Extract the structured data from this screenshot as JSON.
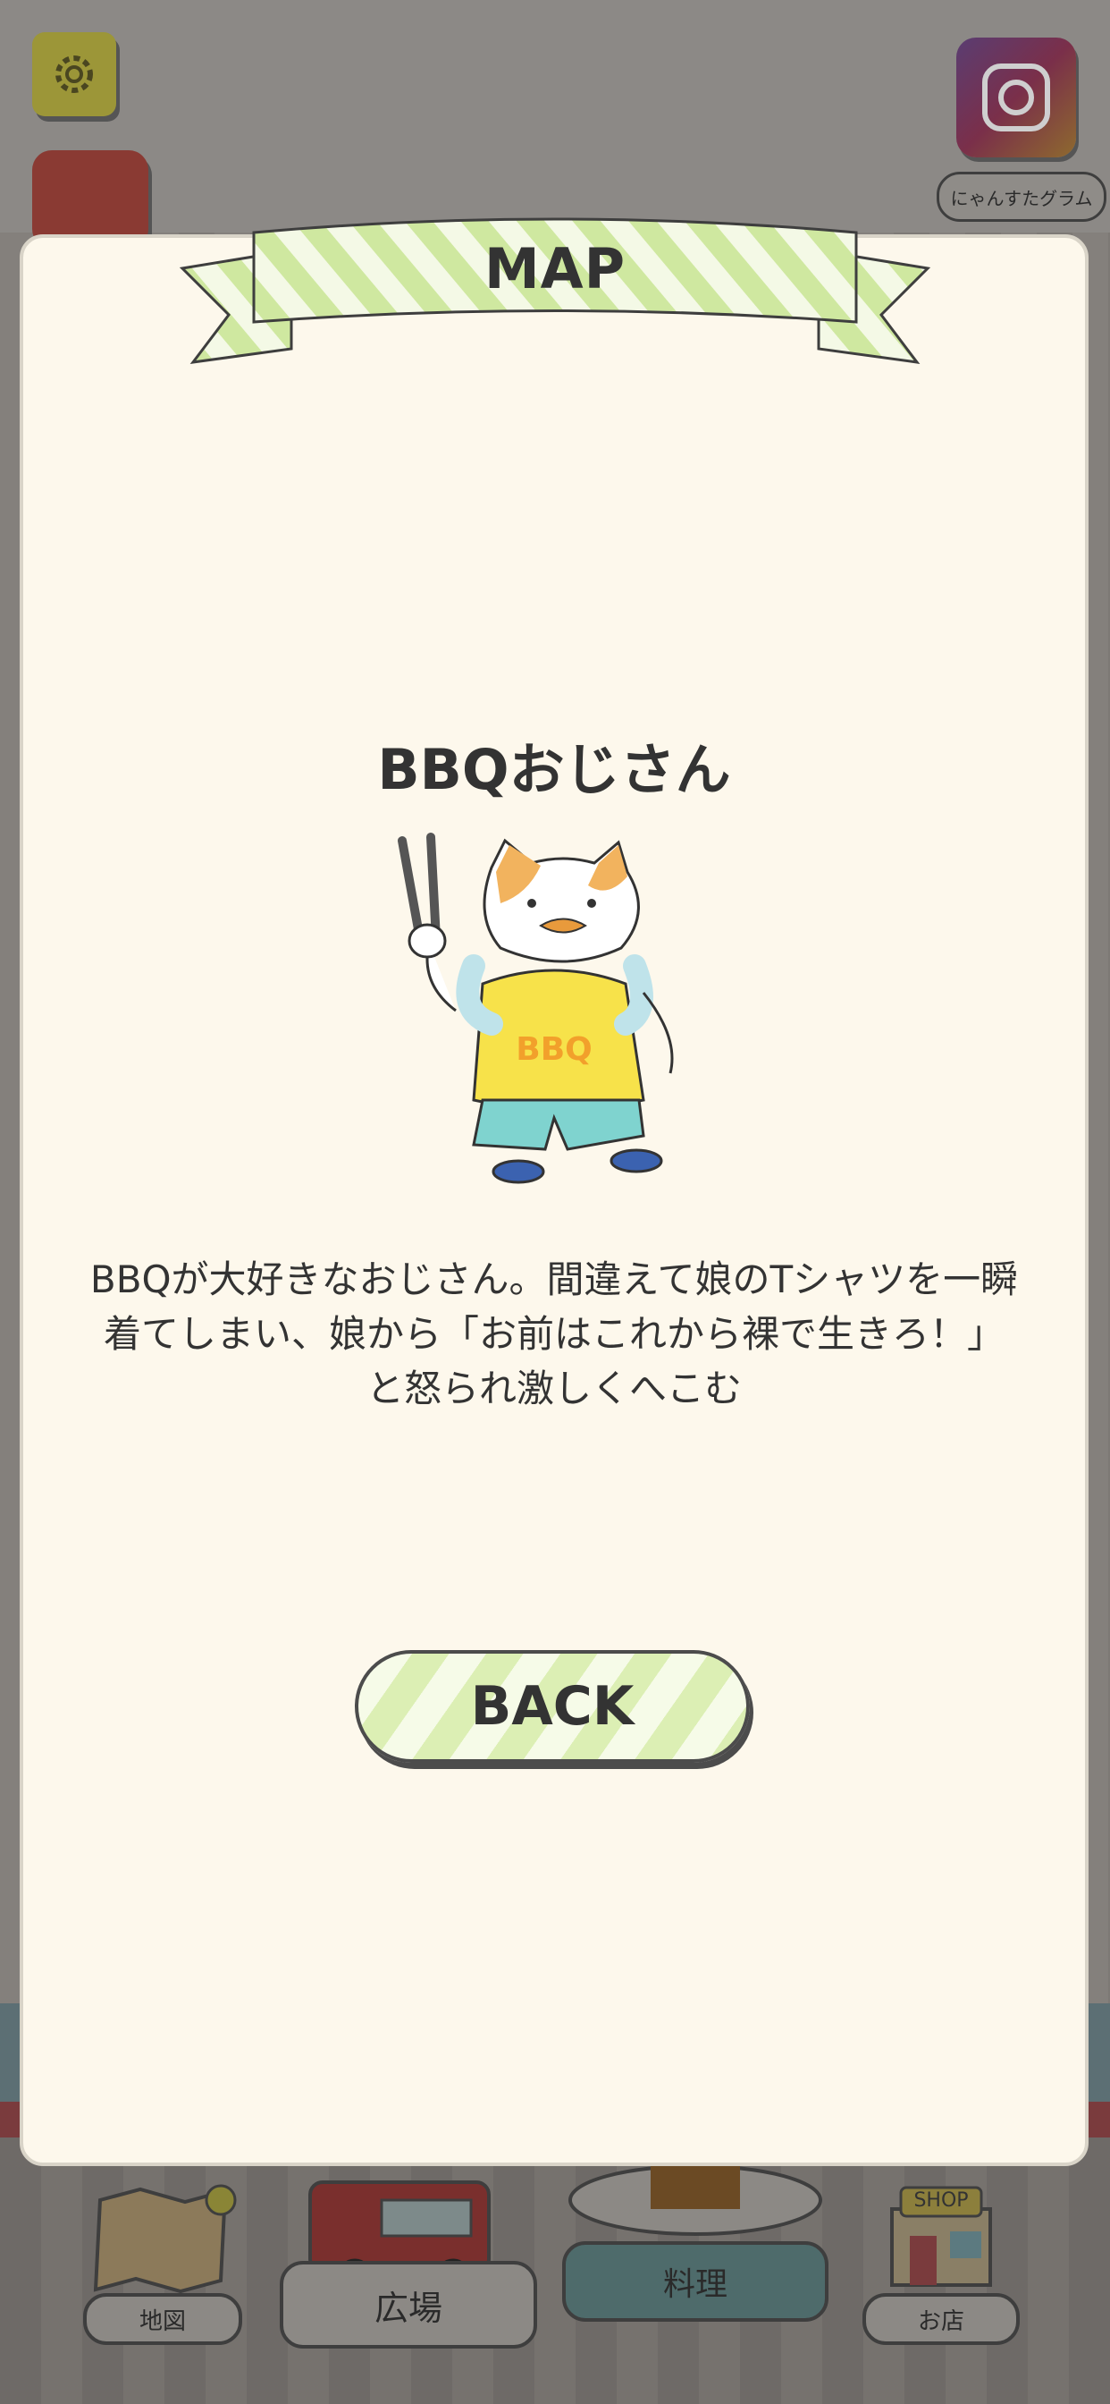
{
  "background": {
    "camera_label": "にゃんすたグラム"
  },
  "bottom_nav": {
    "map_label": "地図",
    "plaza_label": "広場",
    "cook_label": "料理",
    "shop_label": "お店",
    "shop_sign": "SHOP"
  },
  "modal": {
    "title": "MAP",
    "character_name": "BBQおじさん",
    "shirt_text": "BBQ",
    "description": "BBQが大好きなおじさん。間違えて娘のTシャツを一瞬着てしまい、娘から「お前はこれから裸で生きろ！」と怒られ激しくへこむ",
    "back_label": "BACK"
  },
  "colors": {
    "modal_bg": "#fdf8ec",
    "ribbon_green": "#cfe8a0",
    "shirt_yellow": "#f7e24a",
    "shorts_teal": "#7fd3cf"
  }
}
